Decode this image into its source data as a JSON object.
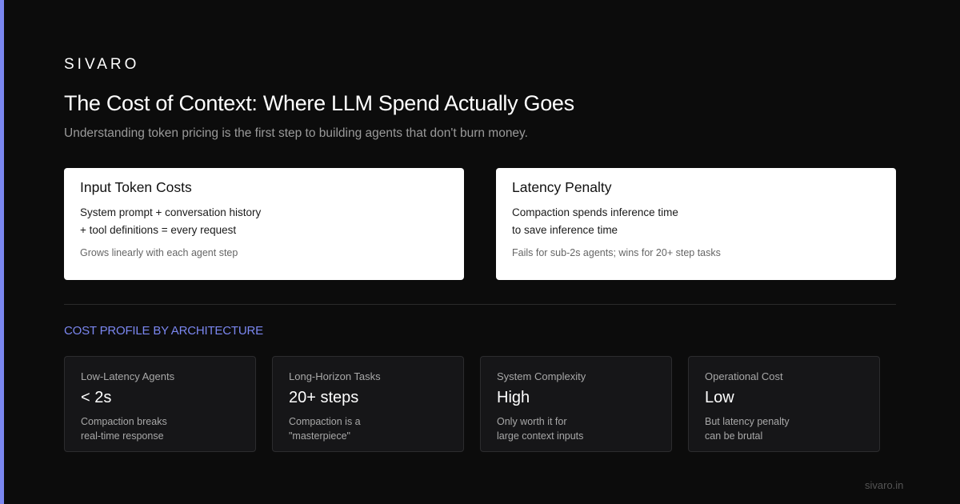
{
  "brand": "SIVARO",
  "title": "The Cost of Context: Where LLM Spend Actually Goes",
  "subtitle": "Understanding token pricing is the first step to building agents that don't burn money.",
  "cards": [
    {
      "title": "Input Token Costs",
      "line1": "System prompt + conversation history",
      "line2": "+ tool definitions = every request",
      "note": "Grows linearly with each agent step"
    },
    {
      "title": "Latency Penalty",
      "line1": "Compaction spends inference time",
      "line2": "to save inference time",
      "note": "Fails for sub-2s agents; wins for 20+ step tasks"
    }
  ],
  "section_label": "COST PROFILE BY ARCHITECTURE",
  "stats": [
    {
      "label": "Low-Latency Agents",
      "value": "< 2s",
      "desc": "Compaction breaks\nreal-time response"
    },
    {
      "label": "Long-Horizon Tasks",
      "value": "20+ steps",
      "desc": "Compaction is a\n\"masterpiece\""
    },
    {
      "label": "System Complexity",
      "value": "High",
      "desc": "Only worth it for\nlarge context inputs"
    },
    {
      "label": "Operational Cost",
      "value": "Low",
      "desc": "But latency penalty\ncan be brutal"
    }
  ],
  "footer": "sivaro.in",
  "colors": {
    "accent": "#7b87f0",
    "background": "#0c0c0c",
    "card": "#ffffff"
  }
}
